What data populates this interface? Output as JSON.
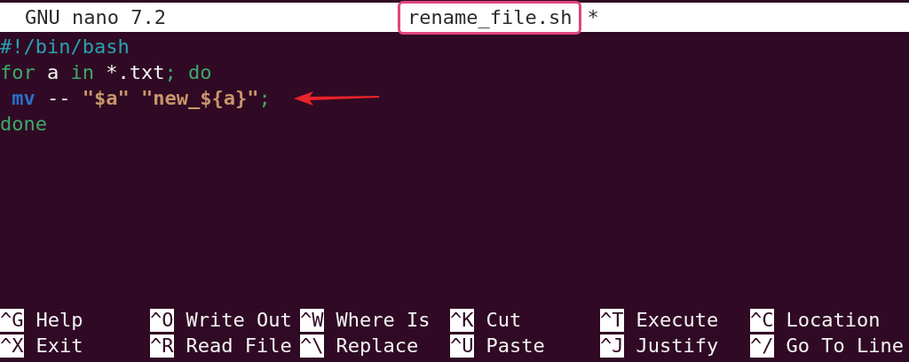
{
  "title_bar": {
    "program": "GNU nano 7.2",
    "filename": "rename_file.sh",
    "filename_highlighted": true,
    "modified": "*"
  },
  "lines": [
    {
      "tokens": [
        {
          "text": "#!/bin/bash",
          "kind": "comment"
        }
      ]
    },
    {
      "tokens": [
        {
          "text": "for",
          "kind": "keyword"
        },
        {
          "text": " a ",
          "kind": "plain"
        },
        {
          "text": "in",
          "kind": "keyword"
        },
        {
          "text": " *.txt",
          "kind": "plain"
        },
        {
          "text": "; do",
          "kind": "keyword"
        }
      ]
    },
    {
      "tokens": [
        {
          "text": " mv",
          "kind": "command"
        },
        {
          "text": " -- ",
          "kind": "plain"
        },
        {
          "text": "\"$a\" \"new_${a}\"",
          "kind": "string"
        },
        {
          "text": ";",
          "kind": "keyword"
        }
      ],
      "arrow": true
    },
    {
      "tokens": [
        {
          "text": "done",
          "kind": "keyword"
        }
      ]
    }
  ],
  "shortcuts": [
    {
      "key": "^G",
      "label": "Help"
    },
    {
      "key": "^O",
      "label": "Write Out"
    },
    {
      "key": "^W",
      "label": "Where Is"
    },
    {
      "key": "^K",
      "label": "Cut"
    },
    {
      "key": "^T",
      "label": "Execute"
    },
    {
      "key": "^C",
      "label": "Location"
    },
    {
      "key": "^X",
      "label": "Exit"
    },
    {
      "key": "^R",
      "label": "Read File"
    },
    {
      "key": "^\\",
      "label": "Replace"
    },
    {
      "key": "^U",
      "label": "Paste"
    },
    {
      "key": "^J",
      "label": "Justify"
    },
    {
      "key": "^/",
      "label": "Go To Line"
    }
  ]
}
